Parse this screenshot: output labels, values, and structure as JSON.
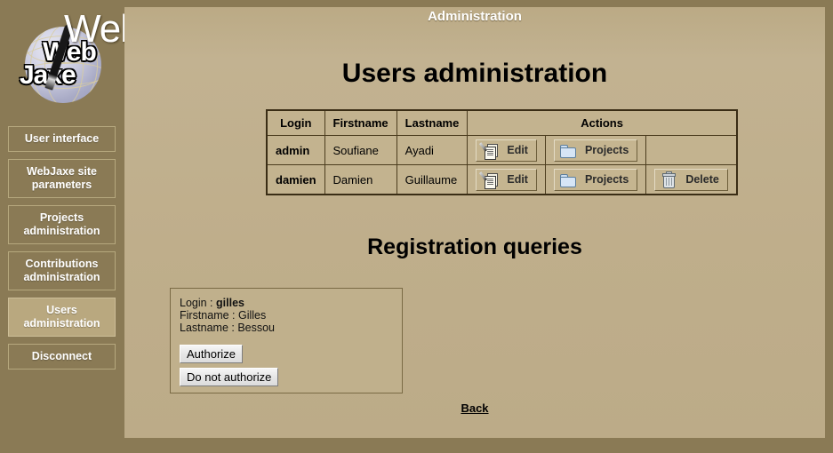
{
  "app": {
    "logo_wordmark": "WebJaxe",
    "logo_badge_line1": "Web",
    "logo_badge_line2": "Jaxe",
    "banner": "Administration"
  },
  "sidebar": {
    "items": [
      {
        "label": "User interface",
        "active": false
      },
      {
        "label": "WebJaxe site parameters",
        "active": false
      },
      {
        "label": "Projects administration",
        "active": false
      },
      {
        "label": "Contributions administration",
        "active": false
      },
      {
        "label": "Users administration",
        "active": true
      },
      {
        "label": "Disconnect",
        "active": false
      }
    ]
  },
  "main": {
    "page_title": "Users administration",
    "registration_title": "Registration queries",
    "back_label": "Back"
  },
  "users_table": {
    "headers": [
      "Login",
      "Firstname",
      "Lastname",
      "Actions"
    ],
    "rows": [
      {
        "login": "admin",
        "firstname": "Soufiane",
        "lastname": "Ayadi",
        "actions": [
          {
            "label": "Edit",
            "icon": "edit-icon"
          },
          {
            "label": "Projects",
            "icon": "folder-icon"
          }
        ]
      },
      {
        "login": "damien",
        "firstname": "Damien",
        "lastname": "Guillaume",
        "actions": [
          {
            "label": "Edit",
            "icon": "edit-icon"
          },
          {
            "label": "Projects",
            "icon": "folder-icon"
          },
          {
            "label": "Delete",
            "icon": "trash-icon"
          }
        ]
      }
    ]
  },
  "registration_queries": [
    {
      "login_label": "Login : ",
      "login_value": "gilles",
      "firstname_line": "Firstname : Gilles",
      "lastname_line": "Lastname : Bessou",
      "authorize_label": "Authorize",
      "deny_label": "Do not authorize"
    }
  ],
  "colors": {
    "sidebar_bg": "#8a7a55",
    "content_bg": "#bfae8b",
    "table_border": "#3a2d15",
    "active_nav": "#b9a87f"
  }
}
